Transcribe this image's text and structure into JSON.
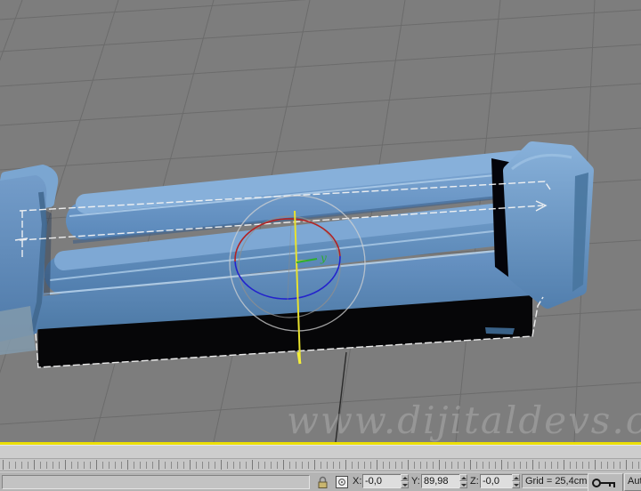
{
  "viewport": {
    "watermark": "www.dijitaldevs.com",
    "background_color": "#7d7d7d",
    "grid_line_color": "#6b6b6b",
    "active_border_color": "#ecdf05",
    "model_color": "#6391c3",
    "selection_color": "#f4f4f4",
    "gizmo": {
      "axis_label": "y",
      "x_ring_color": "#b22222",
      "z_ring_color": "#2323cc",
      "active_axis_color": "#e8e22e",
      "y_axis_color": "#2eae2e",
      "screen_ring_color": "#d2d2d2"
    }
  },
  "status_bar": {
    "prompt_value": "",
    "x_label": "X:",
    "x_value": "-0,0",
    "y_label": "Y:",
    "y_value": "89,98",
    "z_label": "Z:",
    "z_value": "-0,0",
    "grid_display": "Grid = 25,4cm",
    "auto_key_label": "Auto"
  }
}
